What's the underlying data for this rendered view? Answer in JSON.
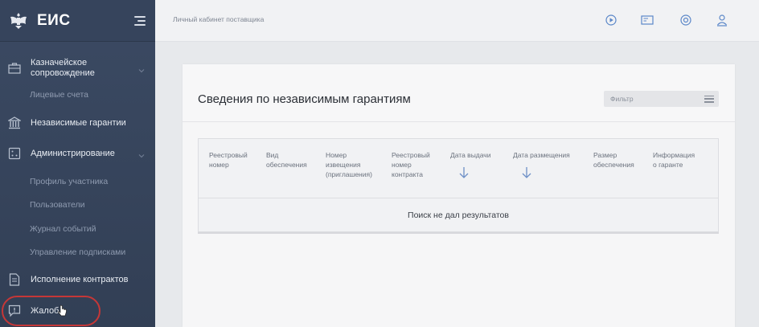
{
  "sidebar": {
    "brand_title": "ЕИС",
    "items": [
      {
        "label": "Казначейское сопровождение",
        "icon": "briefcase-icon"
      },
      {
        "label": "Лицевые счета"
      },
      {
        "label": "Независимые гарантии",
        "icon": "bank-icon"
      },
      {
        "label": "Администрирование",
        "icon": "admin-icon"
      },
      {
        "label": "Профиль участника"
      },
      {
        "label": "Пользователи"
      },
      {
        "label": "Журнал событий"
      },
      {
        "label": "Управление подписками"
      },
      {
        "label": "Исполнение контрактов",
        "icon": "document-icon"
      },
      {
        "label": "Жалобы",
        "icon": "complaint-icon"
      }
    ],
    "item0_line1": "Казначейское",
    "item0_line2": "сопровождение",
    "item9_visible": "Жалоб"
  },
  "topbar": {
    "breadcrumb": "Личный кабинет поставщика",
    "icons": [
      "play-icon",
      "card-icon",
      "settings-icon",
      "user-icon"
    ]
  },
  "main": {
    "title": "Сведения по независимым гарантиям",
    "filter_placeholder": "Фильтр",
    "columns": [
      [
        "Реестровый",
        "номер"
      ],
      [
        "Вид",
        "обеспечения"
      ],
      [
        "Номер",
        "извещения",
        "(приглашения)"
      ],
      [
        "Реестровый",
        "номер",
        "контракта"
      ],
      [
        "Дата выдачи"
      ],
      [
        "Дата размещения"
      ],
      [
        "Размер",
        "обеспечения"
      ],
      [
        "Информация",
        "о гаранте"
      ]
    ],
    "empty_message": "Поиск не дал результатов"
  },
  "colors": {
    "sidebar": "#3b4a63",
    "highlight": "#c63737",
    "background": "#e7e9ec"
  }
}
